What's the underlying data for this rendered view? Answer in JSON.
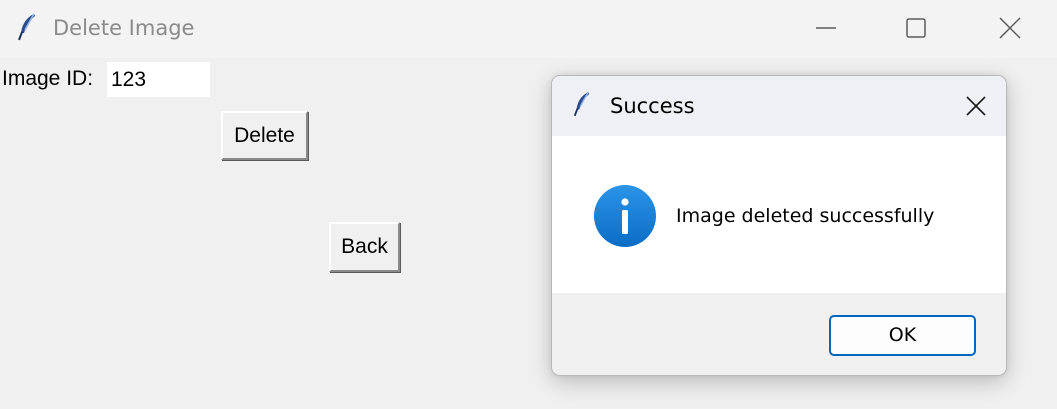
{
  "window": {
    "title": "Delete Image",
    "controls": [
      "minimize",
      "maximize",
      "close"
    ]
  },
  "form": {
    "image_id_label": "Image ID:",
    "image_id_value": "123",
    "delete_label": "Delete",
    "back_label": "Back"
  },
  "dialog": {
    "title": "Success",
    "message": "Image deleted successfully",
    "icon": "info-icon",
    "ok_label": "OK"
  },
  "colors": {
    "accent": "#0067c0",
    "info_icon": "#1a7fd6"
  }
}
